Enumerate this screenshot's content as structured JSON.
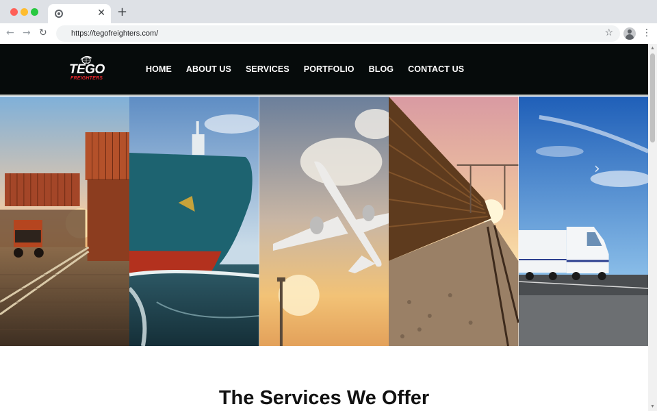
{
  "browser": {
    "url": "https://tegofreighters.com/",
    "icons": {
      "close": "close-icon",
      "new_tab": "plus-icon",
      "back": "arrow-left-icon",
      "forward": "arrow-right-icon",
      "reload": "reload-icon",
      "bookmark": "star-icon",
      "profile": "profile-icon",
      "menu": "more-vertical-icon"
    }
  },
  "site": {
    "logo": {
      "main": "TEGO",
      "sub": "FREIGHTERS"
    },
    "nav": [
      "HOME",
      "ABOUT US",
      "SERVICES",
      "PORTFOLIO",
      "BLOG",
      "CONTACT US"
    ],
    "hero": {
      "panels": [
        "containers",
        "ship",
        "airplane",
        "train",
        "truck"
      ],
      "next_icon": "chevron-right-icon"
    },
    "section_title": "The Services We Offer"
  },
  "colors": {
    "header_bg": "#060b0b",
    "logo_accent": "#e0262b",
    "nav_text": "#ffffff"
  }
}
